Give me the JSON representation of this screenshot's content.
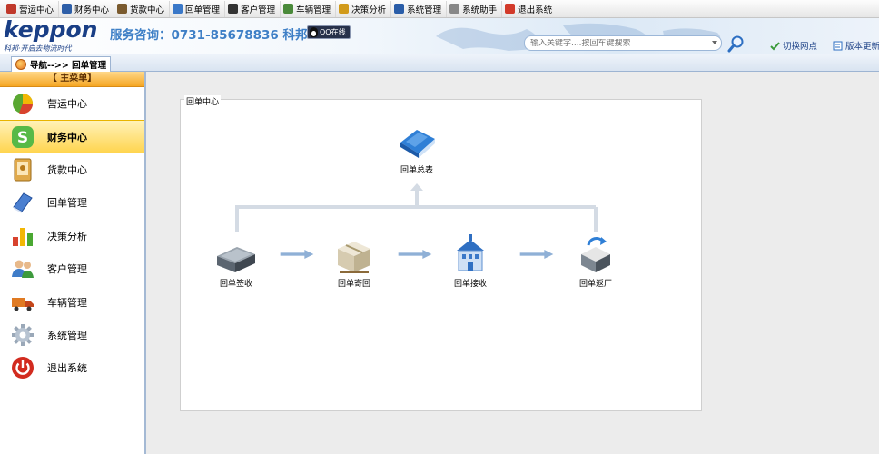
{
  "menu": {
    "items": [
      {
        "label": "营运中心",
        "color": "#c0392b"
      },
      {
        "label": "财务中心",
        "color": "#2e5fa8"
      },
      {
        "label": "货款中心",
        "color": "#7a5a2e"
      },
      {
        "label": "回单管理",
        "color": "#3a78c8"
      },
      {
        "label": "客户管理",
        "color": "#333333"
      },
      {
        "label": "车辆管理",
        "color": "#4a8a3a"
      },
      {
        "label": "决策分析",
        "color": "#d19a1a"
      },
      {
        "label": "系统管理",
        "color": "#2a5da8"
      },
      {
        "label": "系统助手",
        "color": "#888888"
      },
      {
        "label": "退出系统",
        "color": "#d23a2a"
      }
    ]
  },
  "header": {
    "logo": "keppon",
    "slogan": "科邦·开启去物流时代",
    "hotline": "服务咨询：0731-85678836 科邦",
    "qq_label": "QQ在线",
    "search_placeholder": "输入关键字....按回车键搜索",
    "switch_label": "切换网点",
    "version_label": "版本更新"
  },
  "tab": {
    "label": "导航-->> 回单管理"
  },
  "sidebar": {
    "title": "【 主菜单】",
    "items": [
      {
        "label": "营运中心",
        "icon": "pie-chart-icon",
        "active": false
      },
      {
        "label": "财务中心",
        "icon": "finance-s-icon",
        "active": true
      },
      {
        "label": "货款中心",
        "icon": "address-book-icon",
        "active": false
      },
      {
        "label": "回单管理",
        "icon": "book-icon",
        "active": false
      },
      {
        "label": "决策分析",
        "icon": "bar-chart-icon",
        "active": false
      },
      {
        "label": "客户管理",
        "icon": "users-icon",
        "active": false
      },
      {
        "label": "车辆管理",
        "icon": "truck-icon",
        "active": false
      },
      {
        "label": "系统管理",
        "icon": "gear-icon",
        "active": false
      },
      {
        "label": "退出系统",
        "icon": "power-icon",
        "active": false
      }
    ]
  },
  "panel": {
    "title": "回单中心",
    "summary_label": "回单总表",
    "nodes": [
      {
        "label": "回单签收"
      },
      {
        "label": "回单寄回"
      },
      {
        "label": "回单接收"
      },
      {
        "label": "回单返厂"
      }
    ]
  },
  "colors": {
    "active_menu": "#ffd54f",
    "header_blue": "#3e7fc6",
    "arrow": "#8fb0d6"
  }
}
